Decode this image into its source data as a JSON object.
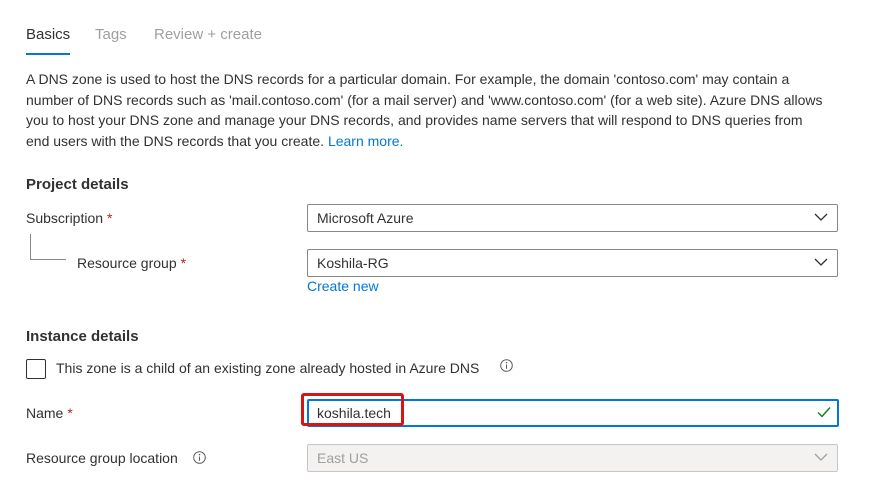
{
  "tabs": [
    {
      "label": "Basics",
      "active": true
    },
    {
      "label": "Tags",
      "active": false
    },
    {
      "label": "Review + create",
      "active": false
    }
  ],
  "description": {
    "text": "A DNS zone is used to host the DNS records for a particular domain. For example, the domain 'contoso.com' may contain a number of DNS records such as 'mail.contoso.com' (for a mail server) and 'www.contoso.com' (for a web site). Azure DNS allows you to host your DNS zone and manage your DNS records, and provides name servers that will respond to DNS queries from end users with the DNS records that you create.",
    "learn_more": "Learn more."
  },
  "project_details": {
    "title": "Project details",
    "subscription": {
      "label": "Subscription",
      "required": "*",
      "value": "Microsoft Azure",
      "icon": "chevron-down-icon"
    },
    "resource_group": {
      "label": "Resource group",
      "required": "*",
      "value": "Koshila-RG",
      "icon": "chevron-down-icon"
    },
    "create_new": "Create new"
  },
  "instance_details": {
    "title": "Instance details",
    "child_zone": {
      "label": "This zone is a child of an existing zone already hosted in Azure DNS",
      "checked": false,
      "icon": "info-icon"
    },
    "name": {
      "label": "Name",
      "required": "*",
      "value": "koshila.tech",
      "valid_icon": "checkmark-icon"
    },
    "rg_location": {
      "label": "Resource group location",
      "value": "East US",
      "disabled": true,
      "icon": "info-icon"
    }
  },
  "colors": {
    "accent": "#0078d4",
    "required": "#a4262c",
    "highlight": "#d61515",
    "valid": "#107c10"
  }
}
